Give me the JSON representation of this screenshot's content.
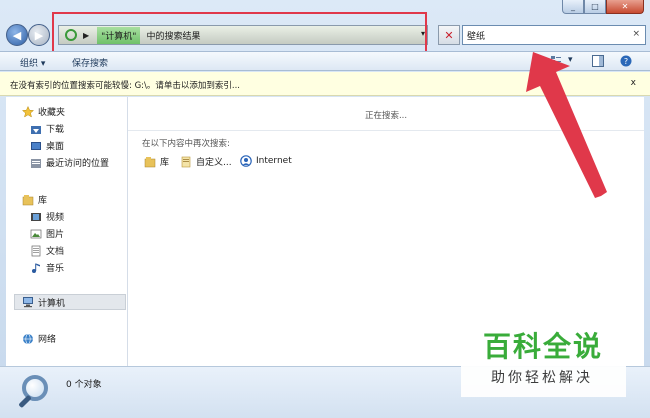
{
  "caption": {
    "min": "_",
    "max": "□",
    "close": "✕"
  },
  "address": {
    "crumb": "\"计算机\"",
    "crumb_rest": "中的搜索结果"
  },
  "search": {
    "value": "壁纸",
    "clear": "×"
  },
  "toolbar": {
    "organize": "组织 ▾",
    "save_search": "保存搜索"
  },
  "infobar": {
    "text": "在没有索引的位置搜索可能较慢: G:\\。请单击以添加到索引...",
    "close": "x"
  },
  "navpane": {
    "favorites": "收藏夹",
    "downloads": "下载",
    "desktop": "桌面",
    "recent": "最近访问的位置",
    "libraries": "库",
    "videos": "视频",
    "pictures": "图片",
    "documents": "文档",
    "music": "音乐",
    "computer": "计算机",
    "network": "网络"
  },
  "content": {
    "searching": "正在搜索...",
    "search_again": "在以下内容中再次搜索:",
    "locations": [
      "库",
      "自定义...",
      "Internet"
    ]
  },
  "status": {
    "count": "0 个对象"
  },
  "watermark": {
    "title": "百科全说",
    "subtitle": "助你轻松解决"
  },
  "colors": {
    "annotation_red": "#e0384a",
    "watermark_green": "#2fa830"
  }
}
